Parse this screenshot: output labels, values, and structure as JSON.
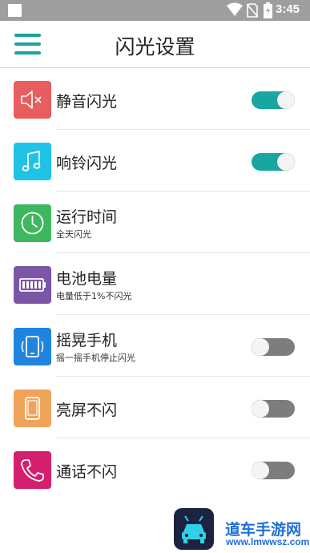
{
  "status_bar": {
    "time": "3:45",
    "battery_icon": "battery-charging-icon",
    "wifi_icon": "wifi-icon",
    "sim_icon": "no-sim-icon"
  },
  "header": {
    "title": "闪光设置",
    "menu_icon": "hamburger-menu-icon"
  },
  "items": [
    {
      "title": "静音闪光",
      "subtitle": "",
      "icon": "mute-speaker-icon",
      "icon_color": "#e85d5e",
      "toggle": "on"
    },
    {
      "title": "响铃闪光",
      "subtitle": "",
      "icon": "music-note-icon",
      "icon_color": "#20c3e6",
      "toggle": "on"
    },
    {
      "title": "运行时间",
      "subtitle": "全天闪光",
      "icon": "clock-icon",
      "icon_color": "#3eb85f",
      "toggle": ""
    },
    {
      "title": "电池电量",
      "subtitle": "电量低于1%不闪光",
      "icon": "battery-icon",
      "icon_color": "#7d55a6",
      "toggle": ""
    },
    {
      "title": "摇晃手机",
      "subtitle": "摇一摇手机停止闪光",
      "icon": "shake-phone-icon",
      "icon_color": "#1f84dd",
      "toggle": "off"
    },
    {
      "title": "亮屏不闪",
      "subtitle": "",
      "icon": "phone-screen-icon",
      "icon_color": "#f0a45a",
      "toggle": "off"
    },
    {
      "title": "通话不闪",
      "subtitle": "",
      "icon": "phone-call-icon",
      "icon_color": "#d31f6e",
      "toggle": "off"
    }
  ],
  "colors": {
    "accent": "#18a6a0",
    "toggle_off": "#7d7d7d"
  },
  "watermark": {
    "text": "道车手游网",
    "url": "www.lmwwsz.com"
  }
}
